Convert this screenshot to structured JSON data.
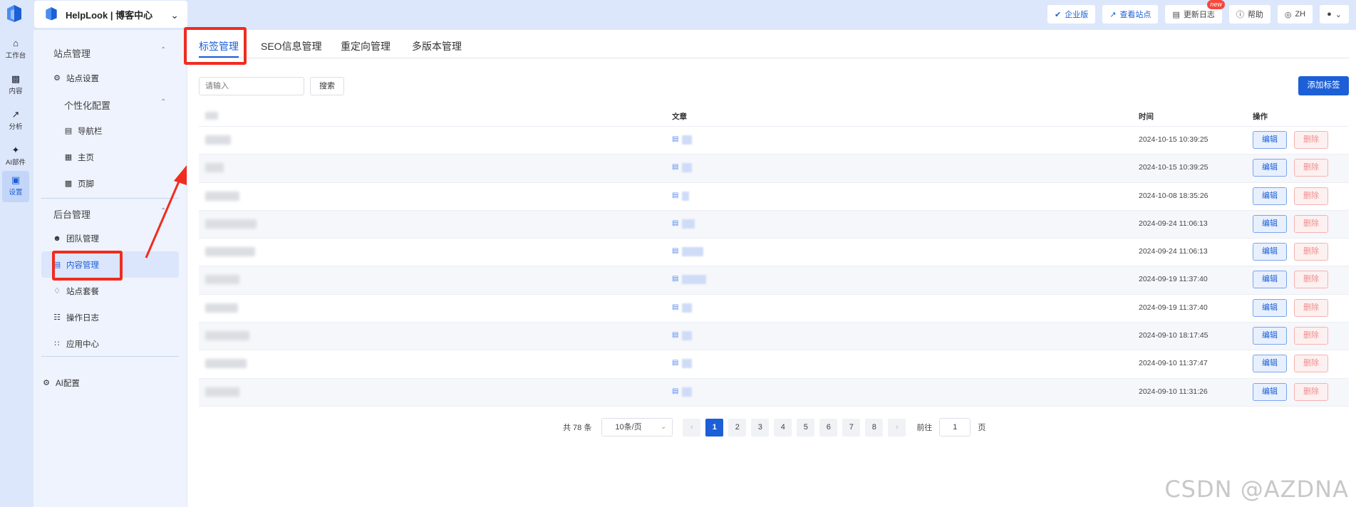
{
  "topbar": {
    "site_name": "HelpLook | 博客中心",
    "actions": [
      {
        "label": "企业版",
        "icon": "check-circle-icon"
      },
      {
        "label": "查看站点",
        "icon": "external-link-icon"
      },
      {
        "label": "更新日志",
        "icon": "document-icon",
        "badge": "new"
      },
      {
        "label": "帮助",
        "icon": "help-icon"
      },
      {
        "label": "ZH",
        "icon": "globe-icon"
      }
    ]
  },
  "rail": {
    "items": [
      {
        "label": "工作台",
        "icon": "home-icon"
      },
      {
        "label": "内容",
        "icon": "book-icon"
      },
      {
        "label": "分析",
        "icon": "chart-icon"
      },
      {
        "label": "AI部件",
        "icon": "ai-widget-icon"
      },
      {
        "label": "设置",
        "icon": "monitor-icon"
      }
    ]
  },
  "sidebar": {
    "group_site": "站点管理",
    "site_settings": "站点设置",
    "personalize": "个性化配置",
    "navbar": "导航栏",
    "homepage": "主页",
    "footer": "页脚",
    "group_admin": "后台管理",
    "team": "团队管理",
    "content": "内容管理",
    "plan": "站点套餐",
    "log": "操作日志",
    "apps": "应用中心",
    "ai_config": "AI配置"
  },
  "tabs": [
    "标签管理",
    "SEO信息管理",
    "重定向管理",
    "多版本管理"
  ],
  "toolbar": {
    "search_placeholder": "请输入",
    "search_label": "搜索",
    "add_label": "添加标签"
  },
  "table": {
    "headers": {
      "article": "文章",
      "time": "时间",
      "ops": "操作"
    },
    "edit_label": "编辑",
    "delete_label": "删除",
    "rows": [
      {
        "time": "2024-10-15 10:39:25"
      },
      {
        "time": "2024-10-15 10:39:25"
      },
      {
        "time": "2024-10-08 18:35:26"
      },
      {
        "time": "2024-09-24 11:06:13"
      },
      {
        "time": "2024-09-24 11:06:13"
      },
      {
        "time": "2024-09-19 11:37:40"
      },
      {
        "time": "2024-09-19 11:37:40"
      },
      {
        "time": "2024-09-10 18:17:45"
      },
      {
        "time": "2024-09-10 11:37:47"
      },
      {
        "time": "2024-09-10 11:31:26"
      }
    ]
  },
  "pagination": {
    "total": "共 78 条",
    "page_size": "10条/页",
    "pages": [
      "1",
      "2",
      "3",
      "4",
      "5",
      "6",
      "7",
      "8"
    ],
    "current": "1",
    "goto_prefix": "前往",
    "goto_value": "1",
    "goto_suffix": "页"
  },
  "watermark": "CSDN @AZDNA",
  "colors": {
    "accent": "#1c5fd6",
    "annotation": "#f02c1e",
    "rail_bg": "#dde7fb"
  }
}
